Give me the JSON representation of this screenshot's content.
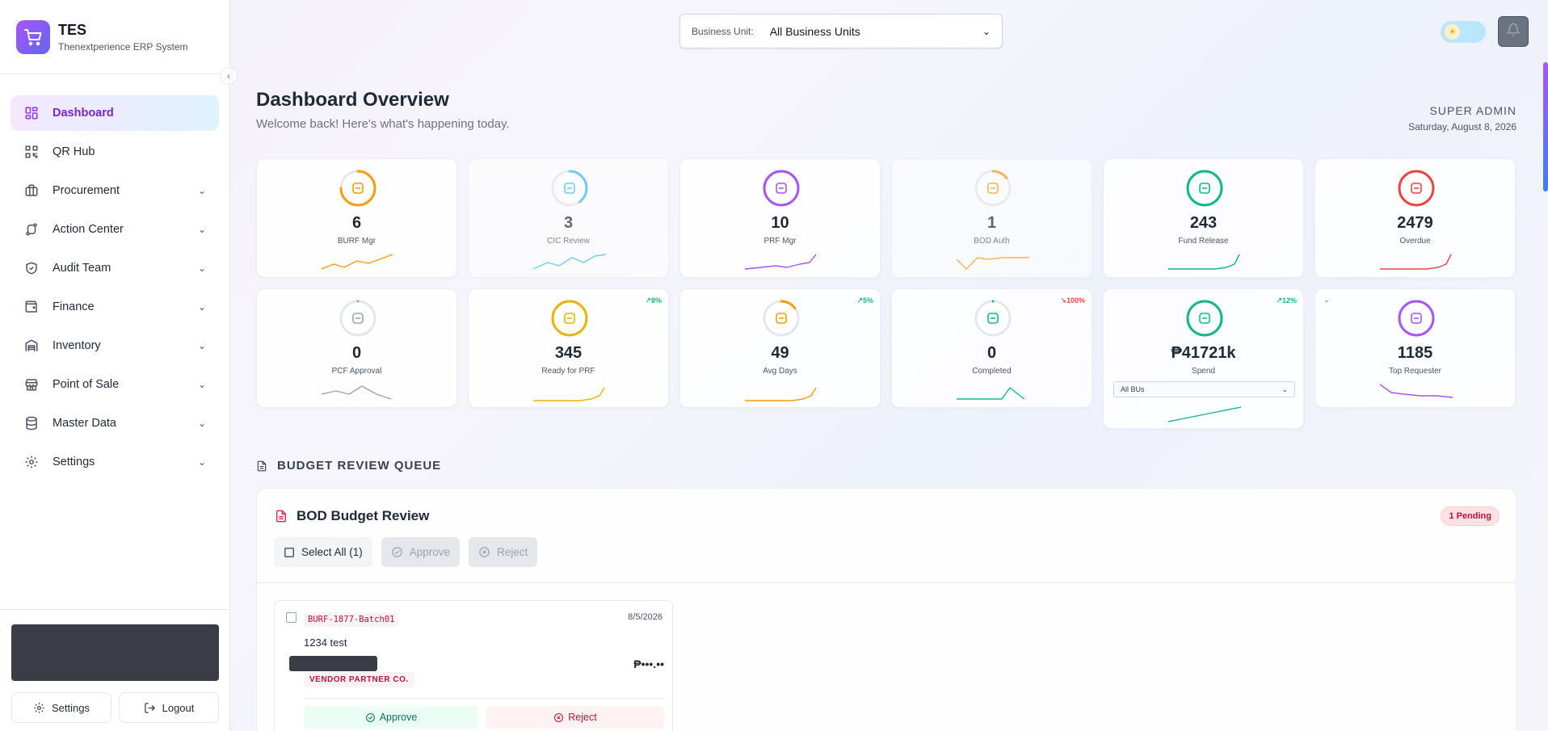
{
  "brand": {
    "title": "TES",
    "subtitle": "Thenextperience ERP System"
  },
  "sidebar": {
    "items": [
      {
        "label": "Dashboard",
        "icon": "dashboard-icon",
        "active": true
      },
      {
        "label": "QR Hub",
        "icon": "qr-icon"
      },
      {
        "label": "Procurement",
        "icon": "briefcase-icon"
      },
      {
        "label": "Action Center",
        "icon": "workflow-icon"
      },
      {
        "label": "Audit Team",
        "icon": "shield-icon"
      },
      {
        "label": "Finance",
        "icon": "wallet-icon"
      },
      {
        "label": "Inventory",
        "icon": "warehouse-icon"
      },
      {
        "label": "Point of Sale",
        "icon": "store-icon"
      },
      {
        "label": "Master Data",
        "icon": "database-icon"
      },
      {
        "label": "Settings",
        "icon": "gear-icon"
      }
    ],
    "settings_label": "Settings",
    "logout_label": "Logout"
  },
  "topbar": {
    "business_unit_label": "Business Unit:",
    "business_unit_value": "All Business Units"
  },
  "header": {
    "title": "Dashboard Overview",
    "subtitle": "Welcome back! Here's what's happening today.",
    "role": "SUPER ADMIN",
    "date": "Saturday, August 8, 2026"
  },
  "stats": [
    {
      "value": "6",
      "label": "BURF Mgr",
      "color": "#f59e0b",
      "ring": 0.75
    },
    {
      "value": "3",
      "label": "CIC Review",
      "color": "#38bdf8",
      "ring": 0.4
    },
    {
      "value": "10",
      "label": "PRF Mgr",
      "color": "#a855f7",
      "ring": 1.0
    },
    {
      "value": "1",
      "label": "BOD Auth",
      "color": "#f59e0b",
      "ring": 0.15
    },
    {
      "value": "243",
      "label": "Fund Release",
      "color": "#10b981",
      "ring": 1.0
    },
    {
      "value": "2479",
      "label": "Overdue",
      "color": "#ef4444",
      "ring": 1.0
    },
    {
      "value": "0",
      "label": "PCF Approval",
      "color": "#9ca3af",
      "ring": 0
    },
    {
      "value": "345",
      "label": "Ready for PRF",
      "color": "#eab308",
      "ring": 1.0,
      "trend": "8%",
      "trend_dir": "up"
    },
    {
      "value": "49",
      "label": "Avg Days",
      "color": "#f59e0b",
      "ring": 0.15,
      "trend": "5%",
      "trend_dir": "up"
    },
    {
      "value": "0",
      "label": "Completed",
      "color": "#10b981",
      "ring": 0,
      "trend": "100%",
      "trend_dir": "down"
    },
    {
      "value": "₱41721k",
      "label": "Spend",
      "color": "#10b981",
      "ring": 1.0,
      "trend": "12%",
      "trend_dir": "up",
      "select_value": "All BUs"
    },
    {
      "value": "1185",
      "label": "Top Requester",
      "color": "#a855f7",
      "ring": 1.0
    }
  ],
  "queue": {
    "section_title": "BUDGET REVIEW QUEUE",
    "panel_title": "BOD Budget Review",
    "pending_badge": "1 Pending",
    "select_all": "Select All (1)",
    "approve": "Approve",
    "reject": "Reject",
    "item": {
      "ref": "BURF-1877-Batch01",
      "date": "8/5/2026",
      "description": "1234 test",
      "amount": "₱•••.••",
      "vendor": "VENDOR PARTNER CO.",
      "approve": "Approve",
      "reject": "Reject"
    }
  }
}
